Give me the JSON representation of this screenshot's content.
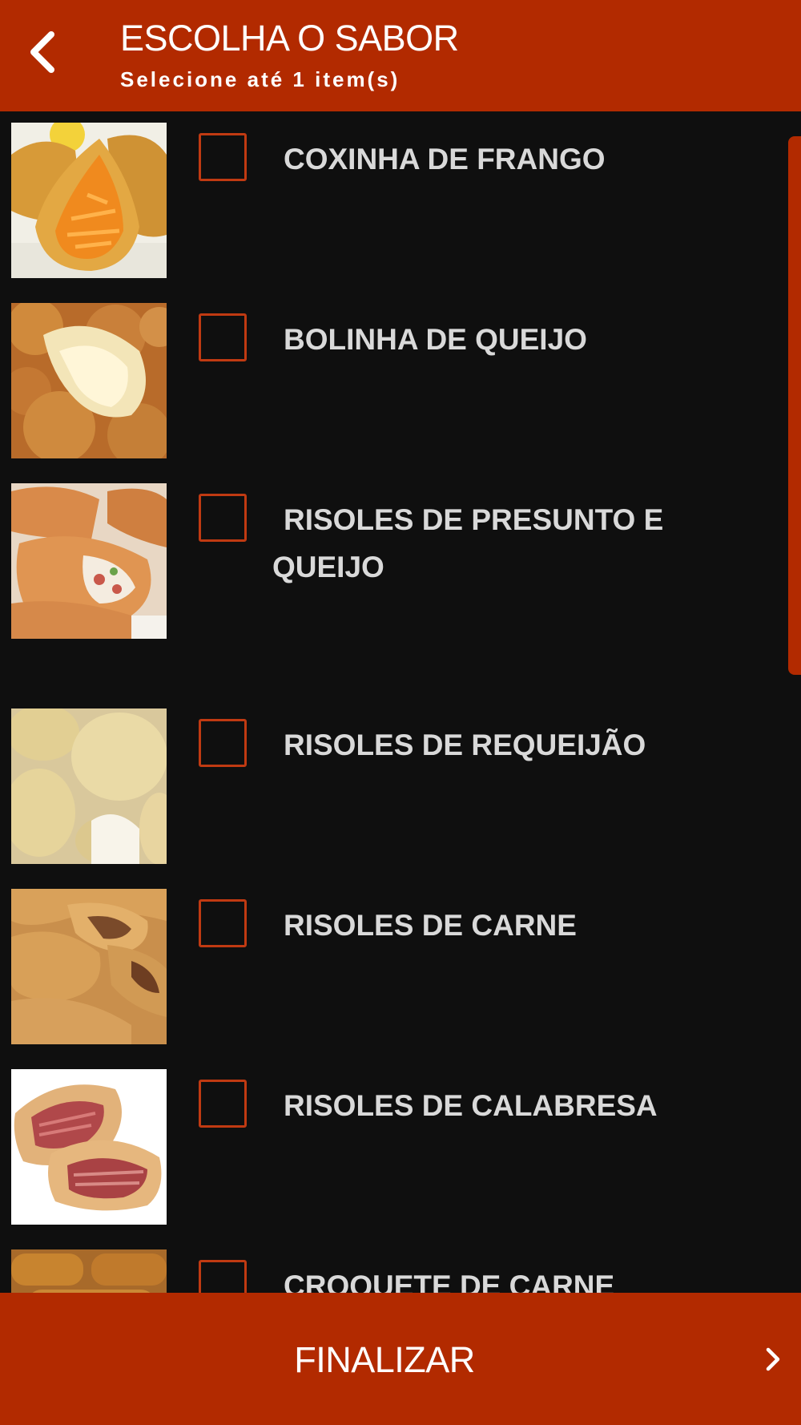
{
  "header": {
    "title": "ESCOLHA O SABOR",
    "subtitle": "Selecione até 1 item(s)",
    "back_icon": "chevron-left-icon"
  },
  "items": [
    {
      "label": "COXINHA DE FRANGO",
      "image": "coxinha-photo",
      "checked": false
    },
    {
      "label": "BOLINHA DE QUEIJO",
      "image": "bolinha-de-queijo-photo",
      "checked": false
    },
    {
      "label": "RISOLES DE PRESUNTO E QUEIJO",
      "image": "risoles-presunto-queijo-photo",
      "checked": false
    },
    {
      "label": "RISOLES DE REQUEIJÃO",
      "image": "risoles-requeijao-photo",
      "checked": false
    },
    {
      "label": "RISOLES DE CARNE",
      "image": "risoles-carne-photo",
      "checked": false
    },
    {
      "label": "RISOLES DE CALABRESA",
      "image": "risoles-calabresa-photo",
      "checked": false
    },
    {
      "label": "CROQUETE DE CARNE",
      "image": "croquete-carne-photo",
      "checked": false
    }
  ],
  "footer": {
    "button_label": "FINALIZAR",
    "chevron_icon": "chevron-right-icon"
  },
  "colors": {
    "accent": "#b22a00",
    "background": "#0f0f0f",
    "checkbox_border": "#c03a12",
    "item_text": "#d9d9d9"
  }
}
